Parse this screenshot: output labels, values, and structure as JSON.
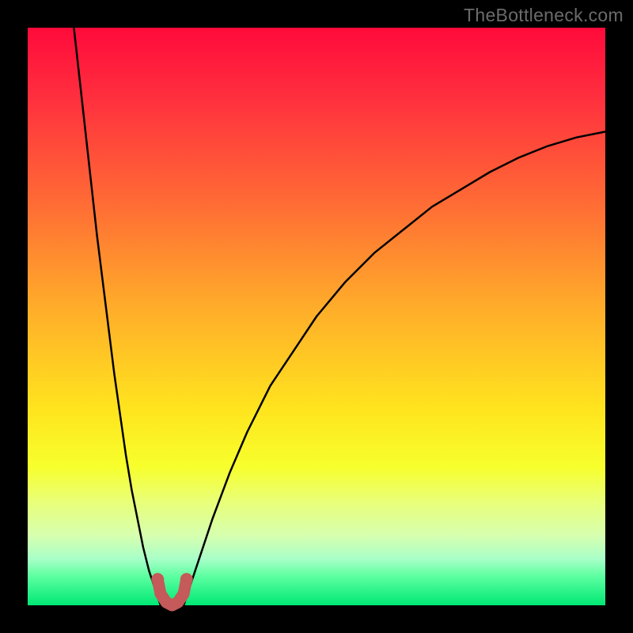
{
  "watermark": "TheBottleneck.com",
  "chart_data": {
    "type": "line",
    "title": "",
    "xlabel": "",
    "ylabel": "",
    "xlim": [
      0,
      100
    ],
    "ylim": [
      0,
      100
    ],
    "grid": false,
    "legend": false,
    "background_gradient": {
      "top": "#ff0a3b",
      "bottom": "#00e874",
      "description": "vertical rainbow red→orange→yellow→green"
    },
    "series": [
      {
        "name": "left-branch",
        "color": "#000000",
        "x": [
          8,
          9,
          10,
          11,
          12,
          13,
          14,
          15,
          16,
          17,
          18,
          19,
          20,
          21,
          22,
          23
        ],
        "y": [
          100,
          91,
          82,
          73,
          64,
          56,
          48,
          40,
          33,
          26,
          20,
          15,
          10,
          6,
          3,
          0
        ]
      },
      {
        "name": "right-branch",
        "color": "#000000",
        "x": [
          27,
          28,
          30,
          32,
          35,
          38,
          42,
          46,
          50,
          55,
          60,
          65,
          70,
          75,
          80,
          85,
          90,
          95,
          100
        ],
        "y": [
          0,
          3,
          9,
          15,
          23,
          30,
          38,
          44,
          50,
          56,
          61,
          65,
          69,
          72,
          75,
          77.5,
          79.5,
          81,
          82
        ]
      },
      {
        "name": "bottom-link",
        "color": "#c45a5a",
        "stroke_width": 15,
        "x": [
          22.5,
          23,
          24,
          25,
          26,
          27,
          27.5
        ],
        "y": [
          4.5,
          2,
          0.5,
          0,
          0.5,
          2,
          4.5
        ]
      }
    ],
    "markers": [
      {
        "x": 22.5,
        "y": 4.5,
        "r": 8,
        "color": "#c45a5a"
      },
      {
        "x": 27.5,
        "y": 4.5,
        "r": 8,
        "color": "#c45a5a"
      }
    ]
  }
}
